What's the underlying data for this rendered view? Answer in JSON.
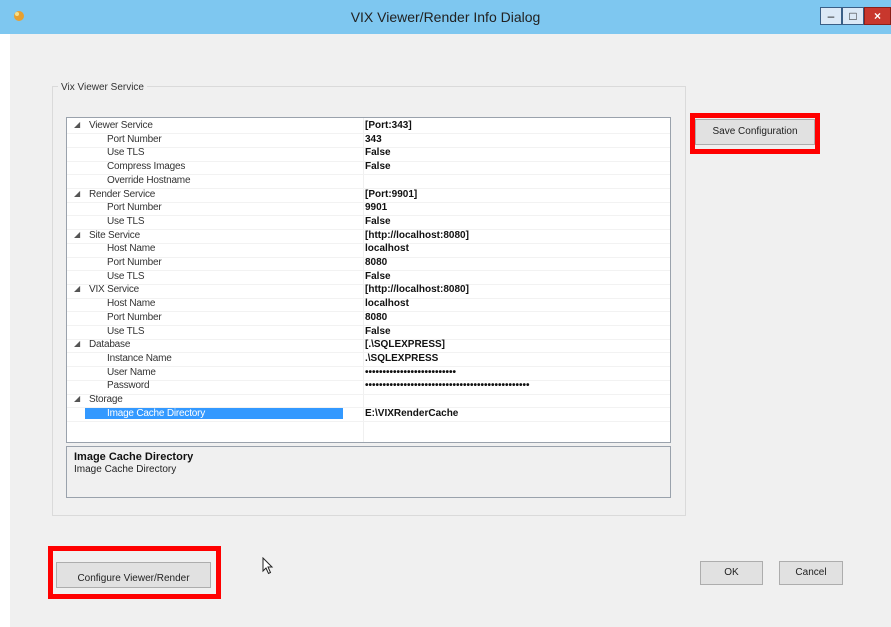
{
  "window": {
    "title": "VIX Viewer/Render Info Dialog"
  },
  "group": {
    "title": "Vix Viewer Service"
  },
  "properties": [
    {
      "name": "Viewer Service",
      "value": "[Port:343]",
      "level": 0,
      "expander": "◢"
    },
    {
      "name": "Port Number",
      "value": "343",
      "level": 1
    },
    {
      "name": "Use TLS",
      "value": "False",
      "level": 1
    },
    {
      "name": "Compress Images",
      "value": "False",
      "level": 1
    },
    {
      "name": "Override Hostname",
      "value": "",
      "level": 1
    },
    {
      "name": "Render Service",
      "value": "[Port:9901]",
      "level": 0,
      "expander": "◢"
    },
    {
      "name": "Port Number",
      "value": "9901",
      "level": 1
    },
    {
      "name": "Use TLS",
      "value": "False",
      "level": 1
    },
    {
      "name": "Site Service",
      "value": "[http://localhost:8080]",
      "level": 0,
      "expander": "◢"
    },
    {
      "name": "Host Name",
      "value": "localhost",
      "level": 1
    },
    {
      "name": "Port Number",
      "value": "8080",
      "level": 1
    },
    {
      "name": "Use TLS",
      "value": "False",
      "level": 1
    },
    {
      "name": "VIX Service",
      "value": "[http://localhost:8080]",
      "level": 0,
      "expander": "◢"
    },
    {
      "name": "Host Name",
      "value": "localhost",
      "level": 1
    },
    {
      "name": "Port Number",
      "value": "8080",
      "level": 1
    },
    {
      "name": "Use TLS",
      "value": "False",
      "level": 1
    },
    {
      "name": "Database",
      "value": "[.\\SQLEXPRESS]",
      "level": 0,
      "expander": "◢"
    },
    {
      "name": "Instance Name",
      "value": ".\\SQLEXPRESS",
      "level": 1
    },
    {
      "name": "User Name",
      "value": "••••••••••••••••••••••••••",
      "level": 1
    },
    {
      "name": "Password",
      "value": "•••••••••••••••••••••••••••••••••••••••••••••••",
      "level": 1
    },
    {
      "name": "Storage",
      "value": "",
      "level": 0,
      "expander": "◢"
    },
    {
      "name": "Image Cache Directory",
      "value": "E:\\VIXRenderCache",
      "level": 1,
      "selected": true
    }
  ],
  "description": {
    "title": "Image Cache Directory",
    "text": "Image Cache Directory"
  },
  "buttons": {
    "save": "Save Configuration",
    "configure": "Configure Viewer/Render",
    "ok": "OK",
    "cancel": "Cancel"
  },
  "window_buttons": {
    "minimize": "–",
    "maximize": "□",
    "close": "×"
  },
  "icons": {
    "app": "app-icon",
    "cursor": "mouse-pointer-icon"
  },
  "colors": {
    "titlebar": "#7ec7f0",
    "selection": "#3399ff",
    "highlight": "#ff0000"
  }
}
